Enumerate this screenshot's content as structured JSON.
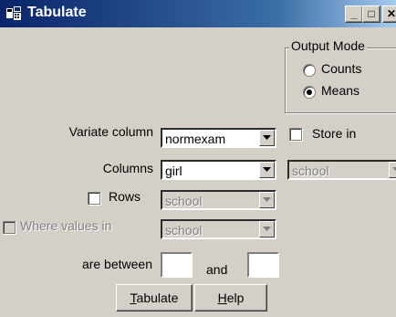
{
  "window": {
    "title": "Tabulate",
    "icon": "table-app-icon"
  },
  "title_buttons": {
    "minimize": "_",
    "maximize": "□",
    "close": "✕"
  },
  "output_mode": {
    "legend": "Output Mode",
    "options": [
      {
        "label": "Counts",
        "selected": false
      },
      {
        "label": "Means",
        "selected": true
      }
    ]
  },
  "variate": {
    "label": "Variate column",
    "value": "normexam"
  },
  "store": {
    "label": "Store in",
    "checked": false,
    "value": "school"
  },
  "columns": {
    "label": "Columns",
    "value": "girl"
  },
  "rows": {
    "label": "Rows",
    "checked": false,
    "value": "school"
  },
  "where": {
    "label": "Where values in",
    "checked": false,
    "value": "school"
  },
  "between": {
    "label": "are between",
    "and_label": "and",
    "low": "",
    "high": ""
  },
  "buttons": {
    "tabulate_label": "Tabulate",
    "tabulate_mnemonic": "T",
    "tabulate_rest": "abulate",
    "help_label": "Help",
    "help_mnemonic": "H",
    "help_rest": "elp"
  },
  "colors": {
    "titlebar_start": "#0a246a",
    "titlebar_end": "#a6caf0",
    "face": "#d4d0c8",
    "disabled_text": "#808080"
  }
}
